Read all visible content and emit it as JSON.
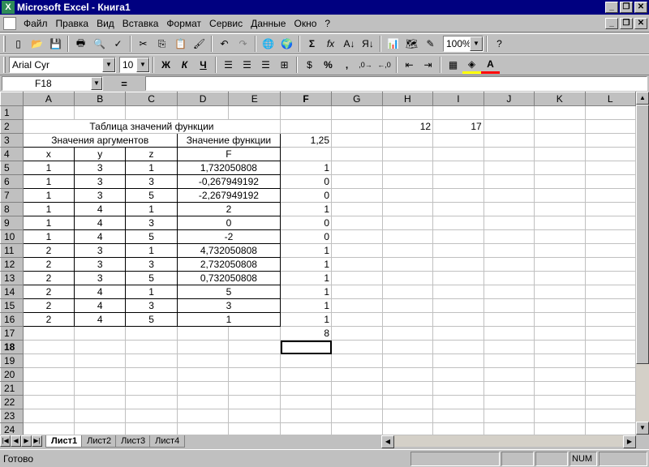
{
  "window": {
    "title": "Microsoft Excel - Книга1"
  },
  "menu": [
    "Файл",
    "Правка",
    "Вид",
    "Вставка",
    "Формат",
    "Сервис",
    "Данные",
    "Окно",
    "?"
  ],
  "format_bar": {
    "font": "Arial Cyr",
    "size": "10",
    "bold": "Ж",
    "italic": "К",
    "underline": "Ч",
    "percent": "%",
    "comma": ","
  },
  "std_bar": {
    "zoom": "100%",
    "autosum": "Σ",
    "fx": "fx"
  },
  "formula_bar": {
    "name_box": "F18",
    "equals": "="
  },
  "columns": [
    "A",
    "B",
    "C",
    "D",
    "E",
    "F",
    "G",
    "H",
    "I",
    "J",
    "K",
    "L"
  ],
  "sheet": {
    "r2_title": "Таблица значений функции",
    "r2_i": "12",
    "r2_j": "17",
    "r3_args": "Значения аргументов",
    "r3_func": "Значение функции",
    "r3_f": "1,25",
    "r4_x": "x",
    "r4_y": "y",
    "r4_z": "z",
    "r4_F": "F",
    "rows": [
      [
        "1",
        "3",
        "1",
        "1,732050808",
        "1"
      ],
      [
        "1",
        "3",
        "3",
        "-0,267949192",
        "0"
      ],
      [
        "1",
        "3",
        "5",
        "-2,267949192",
        "0"
      ],
      [
        "1",
        "4",
        "1",
        "2",
        "1"
      ],
      [
        "1",
        "4",
        "3",
        "0",
        "0"
      ],
      [
        "1",
        "4",
        "5",
        "-2",
        "0"
      ],
      [
        "2",
        "3",
        "1",
        "4,732050808",
        "1"
      ],
      [
        "2",
        "3",
        "3",
        "2,732050808",
        "1"
      ],
      [
        "2",
        "3",
        "5",
        "0,732050808",
        "1"
      ],
      [
        "2",
        "4",
        "1",
        "5",
        "1"
      ],
      [
        "2",
        "4",
        "3",
        "3",
        "1"
      ],
      [
        "2",
        "4",
        "5",
        "1",
        "1"
      ]
    ],
    "r17_f": "8"
  },
  "tabs": [
    "Лист1",
    "Лист2",
    "Лист3",
    "Лист4"
  ],
  "status": {
    "text": "Готово",
    "num": "NUM"
  }
}
